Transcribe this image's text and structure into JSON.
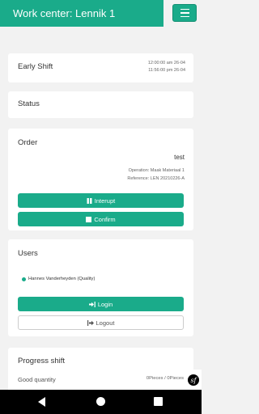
{
  "header": {
    "title": "Work center: Lennik 1"
  },
  "shift": {
    "label": "Early Shift",
    "start": "12:00:00 am 26-04",
    "end": "11:56:00 pm 26-04"
  },
  "status": {
    "label": "Status"
  },
  "order": {
    "label": "Order",
    "name": "test",
    "operation": "Operation: Maak Materiaal 1",
    "reference": "Reference: LEN 20210226-A",
    "interrupt_label": "Interupt",
    "confirm_label": "Confirm"
  },
  "users": {
    "label": "Users",
    "list": [
      {
        "name": "Hannes Vanderheyden (Quality)",
        "status_color": "#1aab8a"
      }
    ],
    "login_label": "Login",
    "logout_label": "Logout"
  },
  "progress": {
    "label": "Progress shift",
    "good_quantity_label": "Good quantity",
    "good_quantity_value": "0Pieces / 0Pieces"
  },
  "colors": {
    "accent": "#1aab8a"
  }
}
